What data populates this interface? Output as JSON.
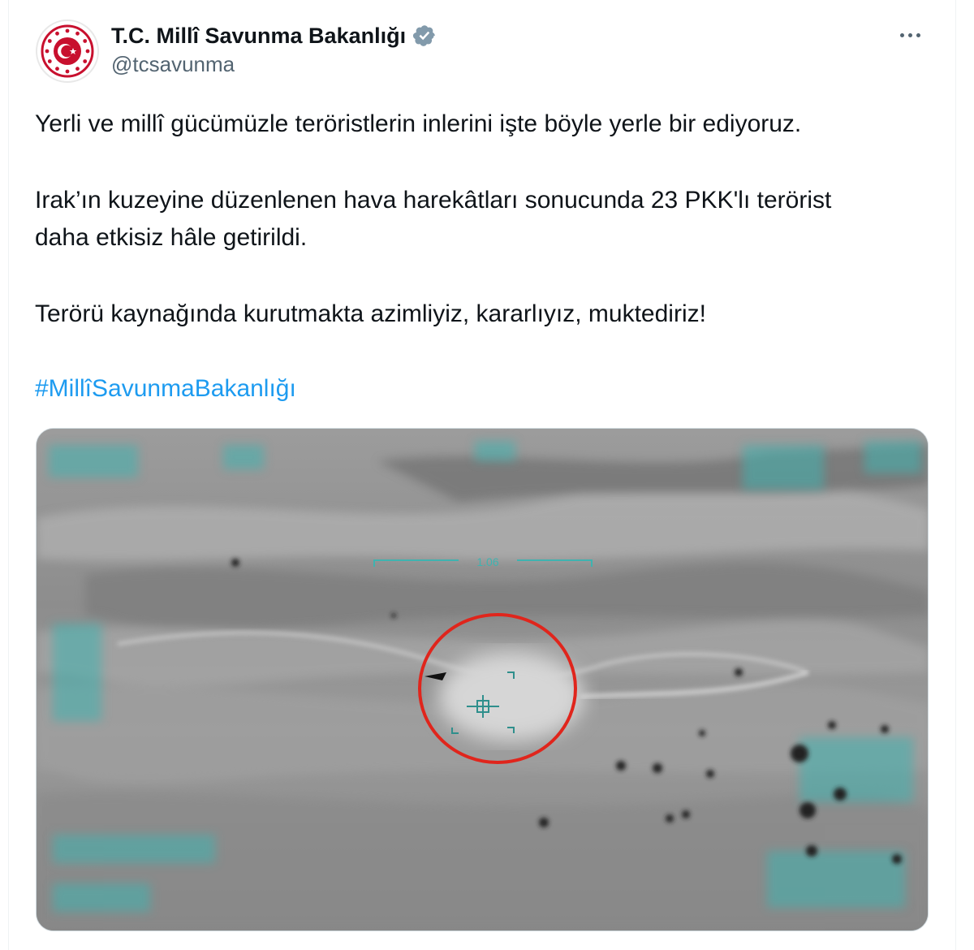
{
  "account": {
    "display_name": "T.C. Millî Savunma Bakanlığı",
    "handle": "@tcsavunma",
    "verified": true,
    "avatar_icon": "ministry-emblem-icon",
    "verified_icon": "verified-badge-icon"
  },
  "menu": {
    "icon": "more-options-icon"
  },
  "tweet": {
    "paragraph1": "Yerli ve millî gücümüzle teröristlerin inlerini işte böyle yerle bir ediyoruz.",
    "paragraph2": "Irak’ın kuzeyine düzenlenen hava harekâtları sonucunda 23 PKK'lı terörist daha etkisiz hâle getirildi.",
    "paragraph3": "Terörü kaynağında kurutmakta azimliyiz, kararlıyız, muktediriz!",
    "hashtag": "#MillîSavunmaBakanlığı"
  },
  "media": {
    "overlay_readout": "1.06",
    "target_marker_color": "#e0251c",
    "hud_color": "#3fb3b0"
  }
}
